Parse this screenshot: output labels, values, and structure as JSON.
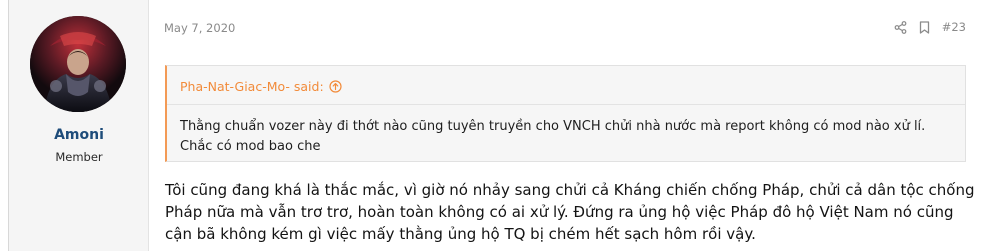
{
  "user": {
    "name": "Amoni",
    "title": "Member"
  },
  "post": {
    "date": "May 7, 2020",
    "number": "#23",
    "quote": {
      "author": "Pha-Nat-Giac-Mo- said:",
      "text": "Thằng chuẩn vozer này đi thớt nào cũng tuyên truyền cho VNCH chửi nhà nước mà report không có mod nào xử lí. Chắc có mod bao che"
    },
    "content": "Tôi cũng đang khá là thắc mắc, vì giờ nó nhảy sang chửi cả Kháng chiến chống Pháp, chửi cả dân tộc chống Pháp nữa mà vẫn trơ trơ, hoàn toàn không có ai xử lý. Đứng ra ủng hộ việc Pháp đô hộ Việt Nam nó cũng cận bã không kém gì việc mấy thằng ủng hộ TQ bị chém hết sạch hôm rồi vậy."
  },
  "icons": {
    "share": "share-icon",
    "bookmark": "bookmark-icon",
    "quote_jump": "arrow-up-circle-icon"
  },
  "colors": {
    "username": "#1e4c7a",
    "quote_accent": "#f39a55",
    "quote_author": "#f28b3a"
  }
}
